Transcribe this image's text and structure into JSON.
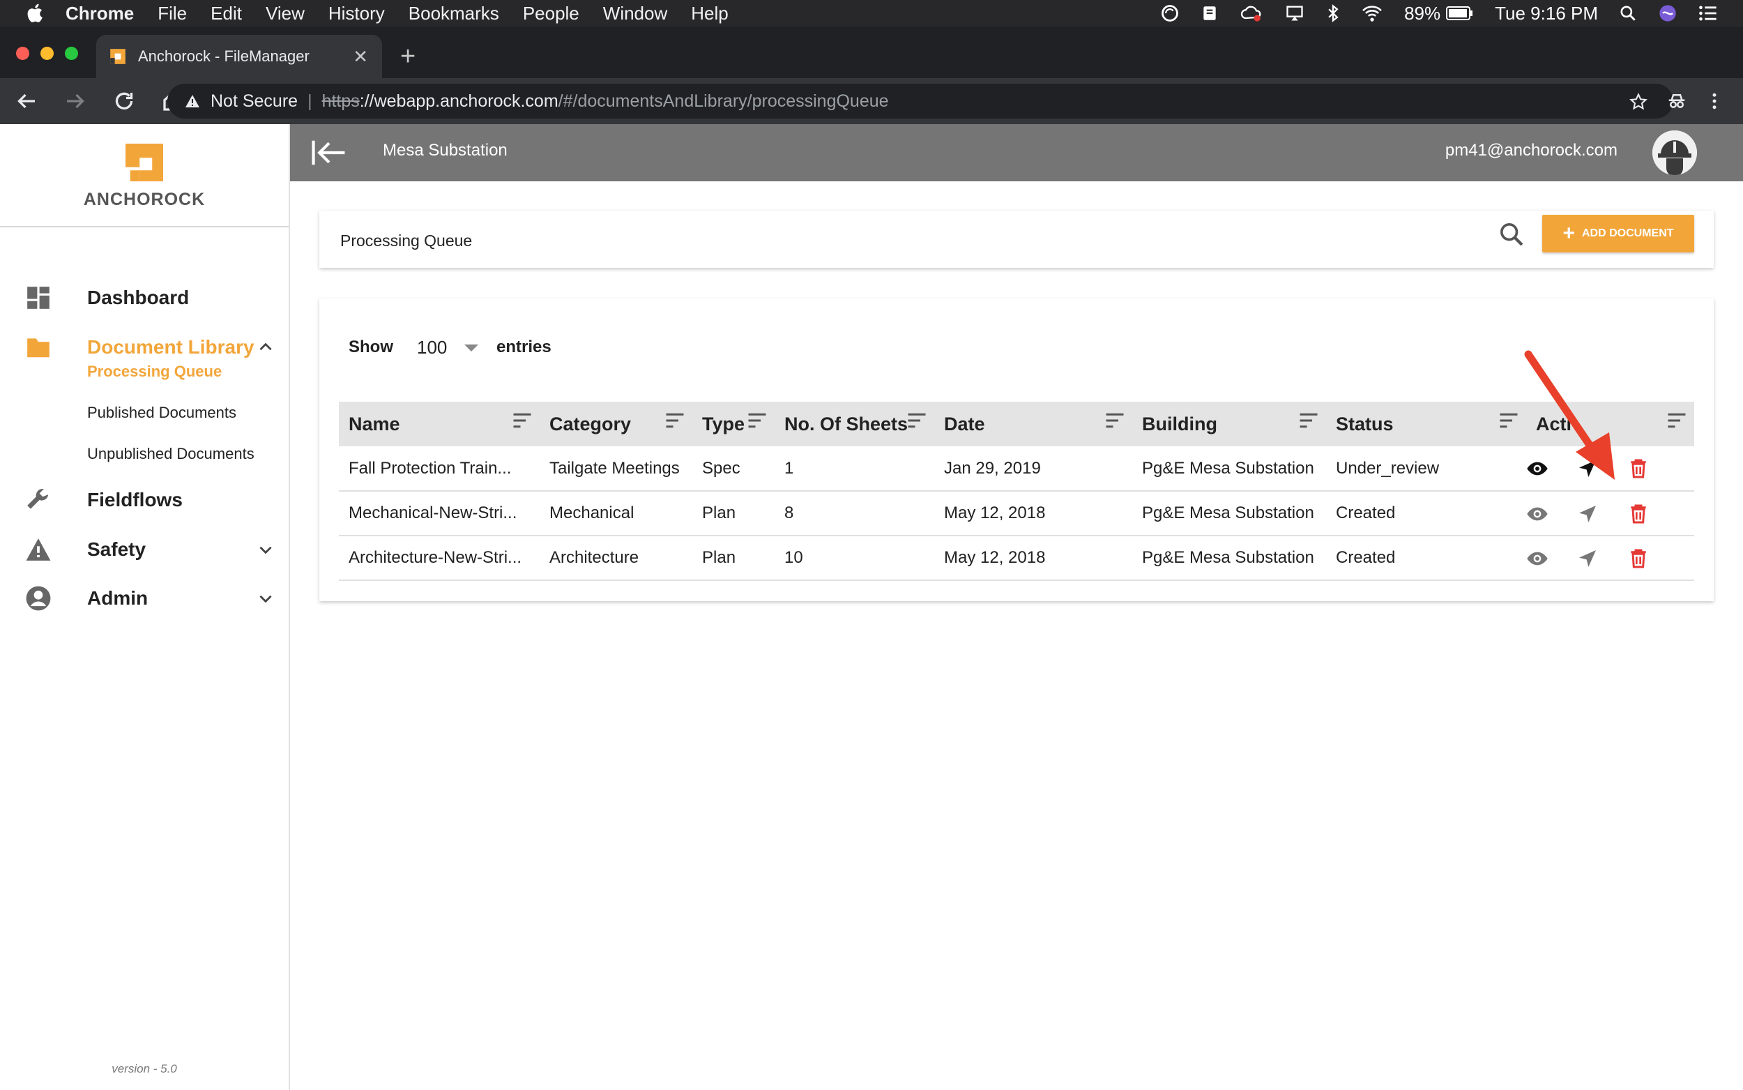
{
  "menubar": {
    "app": "Chrome",
    "items": [
      "File",
      "Edit",
      "View",
      "History",
      "Bookmarks",
      "People",
      "Window",
      "Help"
    ],
    "battery": "89%",
    "clock": "Tue 9:16 PM"
  },
  "browser": {
    "tab_title": "Anchorock - FileManager",
    "security_label": "Not Secure",
    "url_scheme": "https",
    "url_host": "://webapp.anchorock.com",
    "url_path": "/#/documentsAndLibrary/processingQueue"
  },
  "sidebar": {
    "logo_text": "ANCHOROCK",
    "items": [
      {
        "label": "Dashboard",
        "icon": "dashboard-icon"
      },
      {
        "label": "Document Library",
        "icon": "folder-icon"
      },
      {
        "label": "Fieldflows",
        "icon": "wrench-icon"
      },
      {
        "label": "Safety",
        "icon": "warning-icon"
      },
      {
        "label": "Admin",
        "icon": "account-icon"
      }
    ],
    "sub_items": [
      "Processing Queue",
      "Published Documents",
      "Unpublished Documents"
    ],
    "version": "version - 5.0"
  },
  "header": {
    "project": "Mesa Substation",
    "user_email": "pm41@anchorock.com"
  },
  "page": {
    "title": "Processing Queue",
    "add_button": "ADD DOCUMENT",
    "show_label": "Show",
    "entries_value": "100",
    "entries_label": "entries"
  },
  "table": {
    "columns": [
      "Name",
      "Category",
      "Type",
      "No. Of Sheets",
      "Date",
      "Building",
      "Status",
      "Acti"
    ],
    "rows": [
      {
        "name": "Fall Protection Train...",
        "category": "Tailgate Meetings",
        "type": "Spec",
        "sheets": "1",
        "date": "Jan 29, 2019",
        "building": "Pg&E Mesa Substation",
        "status": "Under_review"
      },
      {
        "name": "Mechanical-New-Stri...",
        "category": "Mechanical",
        "type": "Plan",
        "sheets": "8",
        "date": "May 12, 2018",
        "building": "Pg&E Mesa Substation",
        "status": "Created"
      },
      {
        "name": "Architecture-New-Stri...",
        "category": "Architecture",
        "type": "Plan",
        "sheets": "10",
        "date": "May 12, 2018",
        "building": "Pg&E Mesa Substation",
        "status": "Created"
      }
    ]
  },
  "colors": {
    "accent": "#f2a63a",
    "header_bg": "#757575",
    "delete": "#e53935",
    "annotation": "#e8402a"
  }
}
